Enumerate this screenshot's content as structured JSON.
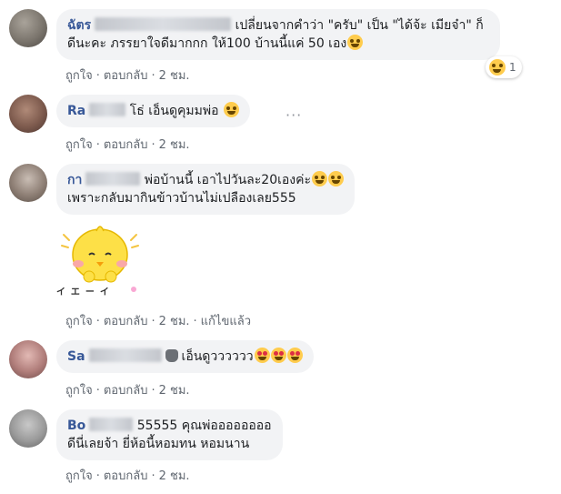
{
  "comments": [
    {
      "name": "ฉัตร",
      "text_line1": "เปลี่ยนจากคำว่า \"ครับ\" เป็น \"ได้จ้ะ เมียจ๋า\" ก็",
      "text_line2": "ดีนะคะ ภรรยาใจดีมากกก ให้100 บ้านนี้แค่ 50 เอง",
      "like": "ถูกใจ",
      "reply": "ตอบกลับ",
      "time": "2 ชม.",
      "reaction_count": "1"
    },
    {
      "name": "Ra",
      "text": "โธ่ เอ็นดูคุมมพ่อ",
      "like": "ถูกใจ",
      "reply": "ตอบกลับ",
      "time": "2 ชม.",
      "more": "···"
    },
    {
      "name": "กา",
      "text_line1": "พ่อบ้านนี้ เอาไปวันละ20เองค่ะ",
      "text_line2": "เพราะกลับมากินข้าวบ้านไม่เปลืองเลย555",
      "like": "ถูกใจ",
      "reply": "ตอบกลับ",
      "time": "2 ชม."
    },
    {
      "sticker": {
        "caption": "イエーイ"
      },
      "like": "ถูกใจ",
      "reply": "ตอบกลับ",
      "time": "2 ชม.",
      "edited": "แก้ไขแล้ว"
    },
    {
      "name": "Sa",
      "text": "เอ็นดูวววววว",
      "like": "ถูกใจ",
      "reply": "ตอบกลับ",
      "time": "2 ชม."
    },
    {
      "name": "Bo",
      "text_line1": "55555 คุณพ่ออออออออ",
      "text_line2": "ดีนี่เลยจ้า ยี่ห้อนี้หอมทน หอมนาน",
      "like": "ถูกใจ",
      "reply": "ตอบกลับ",
      "time": "2 ชม."
    }
  ],
  "colors": {
    "name": "#385898",
    "bubble": "#f2f3f5",
    "meta": "#606770"
  },
  "icons": [
    "laughing-emoji-icon",
    "sweat-smile-emoji-icon",
    "grin-emoji-icon",
    "heart-eyes-emoji-icon",
    "wave-hand-icon"
  ]
}
